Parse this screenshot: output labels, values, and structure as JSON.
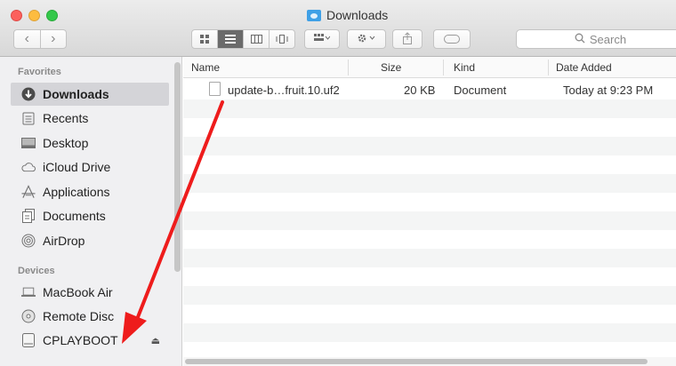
{
  "window": {
    "title": "Downloads"
  },
  "toolbar": {
    "back_icon": "chevron-left-icon",
    "forward_icon": "chevron-right-icon",
    "nav_back": "‹",
    "nav_forward": "›",
    "views": [
      "icon-view-icon",
      "list-view-icon",
      "column-view-icon",
      "cover-flow-icon"
    ],
    "active_view": "list",
    "arrange_icon": "arrange-icon",
    "action_icon": "gear-icon",
    "share_icon": "share-icon",
    "tags_icon": "tag-icon"
  },
  "search": {
    "placeholder": "Search"
  },
  "sidebar": {
    "favorites_heading": "Favorites",
    "favorites": [
      {
        "label": "Downloads",
        "icon": "download-icon",
        "selected": true
      },
      {
        "label": "Recents",
        "icon": "recents-icon"
      },
      {
        "label": "Desktop",
        "icon": "desktop-icon"
      },
      {
        "label": "iCloud Drive",
        "icon": "cloud-icon"
      },
      {
        "label": "Applications",
        "icon": "applications-icon"
      },
      {
        "label": "Documents",
        "icon": "documents-icon"
      },
      {
        "label": "AirDrop",
        "icon": "airdrop-icon"
      }
    ],
    "devices_heading": "Devices",
    "devices": [
      {
        "label": "MacBook Air",
        "icon": "laptop-icon"
      },
      {
        "label": "Remote Disc",
        "icon": "disc-icon"
      },
      {
        "label": "CPLAYBOOT",
        "icon": "drive-icon",
        "eject": "⏏"
      }
    ]
  },
  "columns": {
    "name": "Name",
    "size": "Size",
    "kind": "Kind",
    "date_added": "Date Added"
  },
  "files": [
    {
      "name": "update-b…fruit.10.uf2",
      "size": "20 KB",
      "kind": "Document",
      "date_added": "Today at 9:23 PM"
    }
  ],
  "colors": {
    "annotation_arrow": "#ee1c1c",
    "selection": "#d4d4d8"
  }
}
